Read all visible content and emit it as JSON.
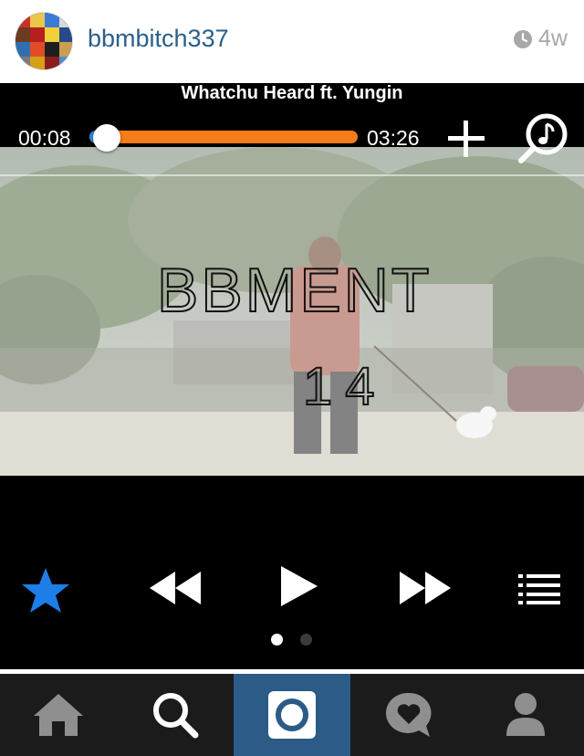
{
  "post": {
    "username": "bbmbitch337",
    "age": "4w"
  },
  "player": {
    "song_title": "Whatchu Heard ft. Yungin",
    "current_time": "00:08",
    "total_time": "03:26",
    "progress_fraction": 0.04,
    "video_text_top": "BBMENT",
    "video_text_bottom": "14",
    "page_count": 2,
    "active_page": 1
  },
  "colors": {
    "username": "#2a5f8a",
    "progress": "#f57c18",
    "progress_played": "#2b8ad8",
    "star": "#1c7ee6",
    "tab_active": "#2b5b86",
    "tabbar": "#1b1b1b"
  },
  "controls": [
    "star-icon",
    "rewind-icon",
    "play-icon",
    "fast-forward-icon",
    "list-icon"
  ],
  "tabbar": {
    "tabs": [
      {
        "name": "home",
        "icon": "home-icon",
        "active": false
      },
      {
        "name": "explore",
        "icon": "search-icon",
        "active": false
      },
      {
        "name": "camera",
        "icon": "camera-icon",
        "active": true
      },
      {
        "name": "activity",
        "icon": "heart-bubble-icon",
        "active": false
      },
      {
        "name": "profile",
        "icon": "person-icon",
        "active": false
      }
    ]
  }
}
